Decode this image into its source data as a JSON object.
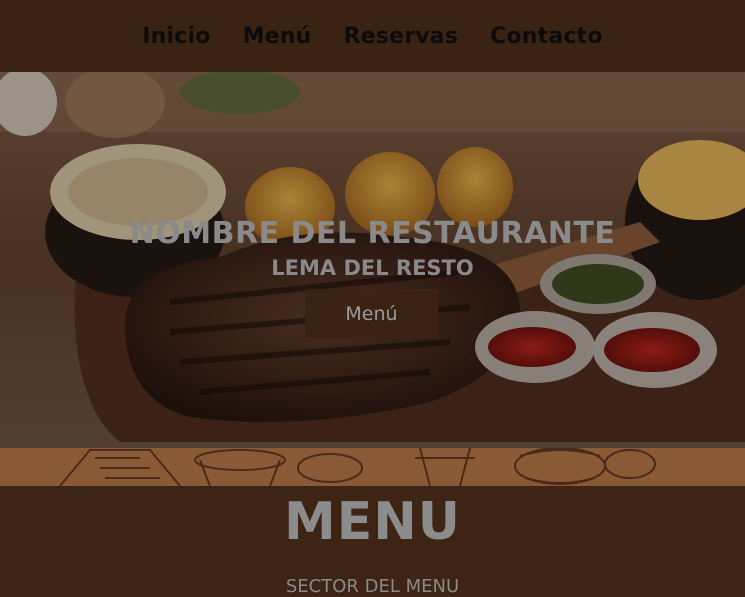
{
  "nav": {
    "items": [
      {
        "label": "Inicio"
      },
      {
        "label": "Menú"
      },
      {
        "label": "Reservas"
      },
      {
        "label": "Contacto"
      }
    ]
  },
  "hero": {
    "title": "NOMBRE DEL RESTAURANTE",
    "slogan": "LEMA DEL RESTO",
    "button_label": "Menú",
    "image": "grilled-steak-platter-photo"
  },
  "menu_section": {
    "heading": "MENU",
    "subtitle": "SECTOR DEL MENU"
  },
  "colors": {
    "nav_bg": "#3b2314",
    "band": "#8a5a36",
    "section_bg": "#3d2414",
    "text_gray": "#8a8a8a"
  }
}
